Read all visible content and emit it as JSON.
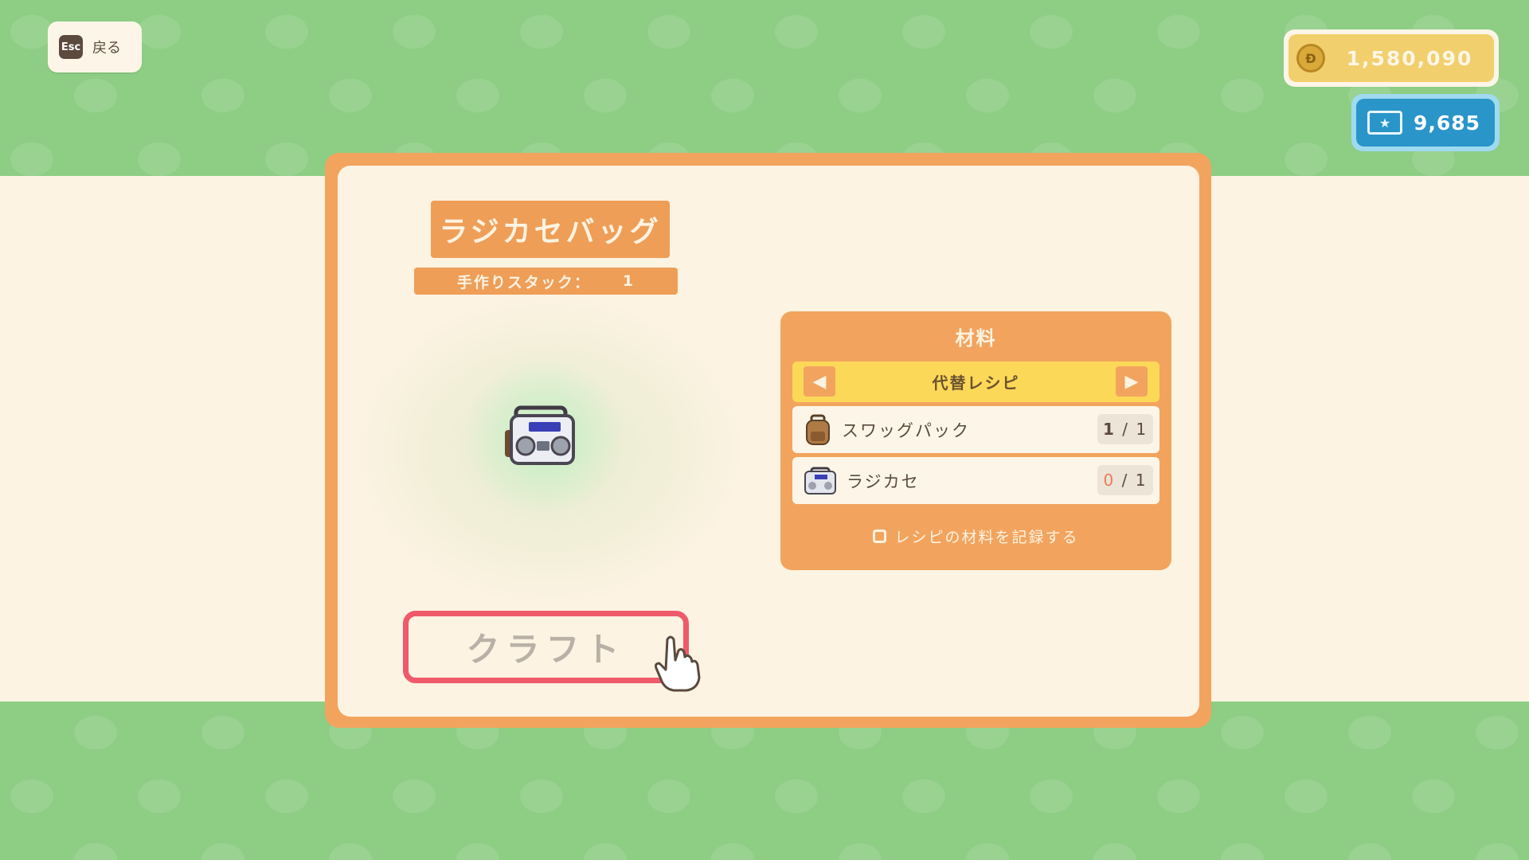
{
  "header": {
    "esc_key": "Esc",
    "back_label": "戻る"
  },
  "currency": {
    "bells": "1,580,090",
    "bell_icon_glyph": "Ð",
    "miles": "9,685"
  },
  "item": {
    "name": "ラジカセバッグ",
    "stack_label": "手作りスタック：",
    "stack_value": "1"
  },
  "craft": {
    "button_label": "クラフト"
  },
  "materials": {
    "title": "材料",
    "recipe_selector": "代替レシピ",
    "prev_arrow": "◀",
    "next_arrow": "▶",
    "rows": [
      {
        "name": "スワッグパック",
        "have": "1",
        "sep": " / ",
        "need": "1",
        "icon": "backpack-icon"
      },
      {
        "name": "ラジカセ",
        "have": "0",
        "sep": " / ",
        "need": "1",
        "icon": "boombox-icon"
      }
    ],
    "record_label": "レシピの材料を記録する"
  },
  "colors": {
    "background_green": "#8dcd84",
    "band_cream": "#fdf3e2",
    "panel_orange": "#f2a45e",
    "recipe_yellow": "#fcd859",
    "craft_border_red": "#ef5a6a",
    "bells_gold": "#f2cf6d",
    "miles_blue": "#2a95c9"
  }
}
